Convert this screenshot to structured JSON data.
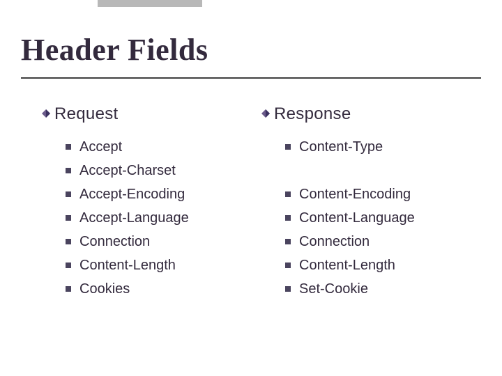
{
  "title": "Header Fields",
  "left": {
    "heading": "Request",
    "items": [
      "Accept",
      "Accept-Charset",
      "Accept-Encoding",
      "Accept-Language",
      "Connection",
      "Content-Length",
      "Cookies"
    ]
  },
  "right": {
    "heading": "Response",
    "items": [
      "Content-Type",
      "",
      "Content-Encoding",
      "Content-Language",
      "Connection",
      "Content-Length",
      "Set-Cookie"
    ]
  }
}
